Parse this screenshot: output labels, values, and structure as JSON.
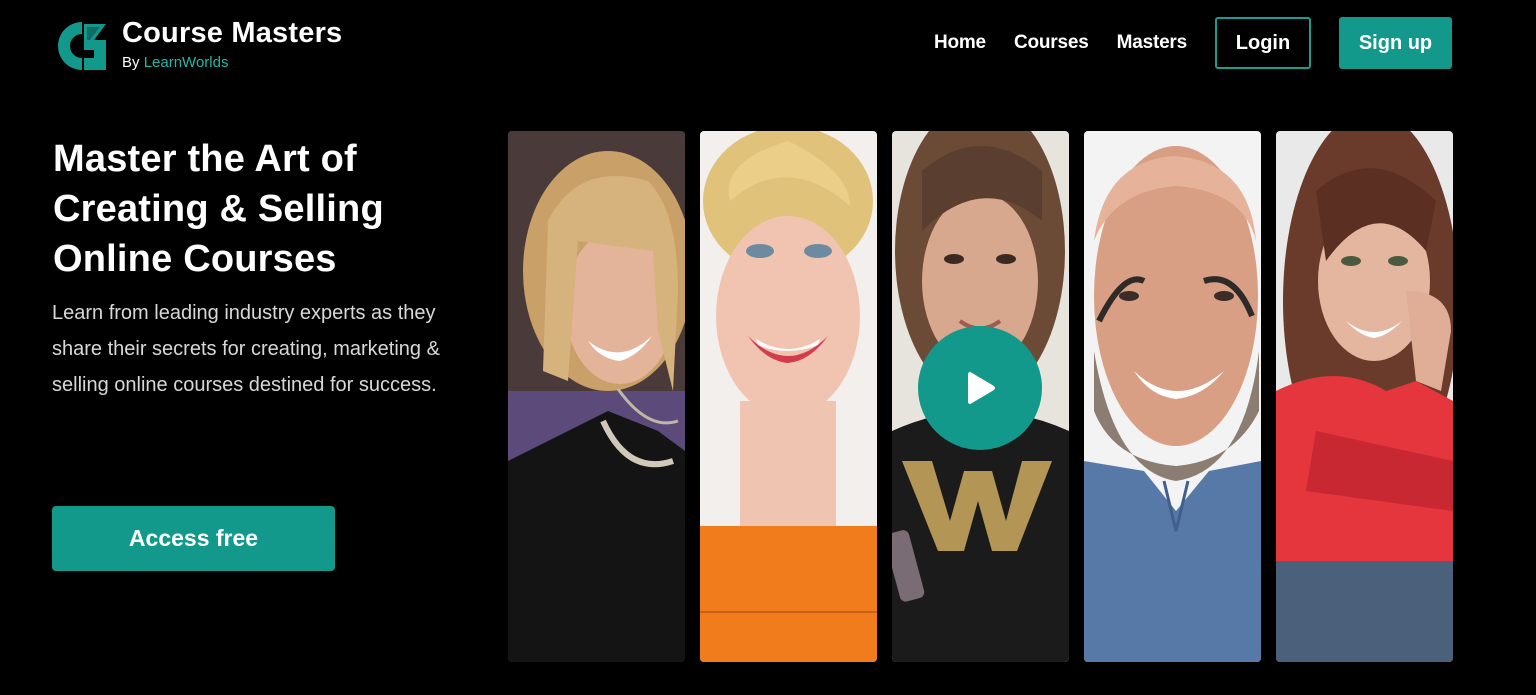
{
  "brand": {
    "title": "Course Masters",
    "sub_prefix": "By",
    "sub_brand": "LearnWorlds",
    "accent": "#13998c"
  },
  "nav": {
    "home": "Home",
    "courses": "Courses",
    "masters": "Masters",
    "login": "Login",
    "signup": "Sign up"
  },
  "hero": {
    "title": "Master the Art of Creating & Selling Online Courses",
    "description": "Learn from leading industry experts as they share their secrets for creating, marketing & selling online courses destined for success.",
    "cta": "Access free"
  },
  "gallery": {
    "portraits": [
      {
        "icon": "portrait-photo"
      },
      {
        "icon": "portrait-photo"
      },
      {
        "icon": "portrait-photo"
      },
      {
        "icon": "portrait-photo"
      },
      {
        "icon": "portrait-photo"
      }
    ],
    "play_icon": "play-icon"
  }
}
